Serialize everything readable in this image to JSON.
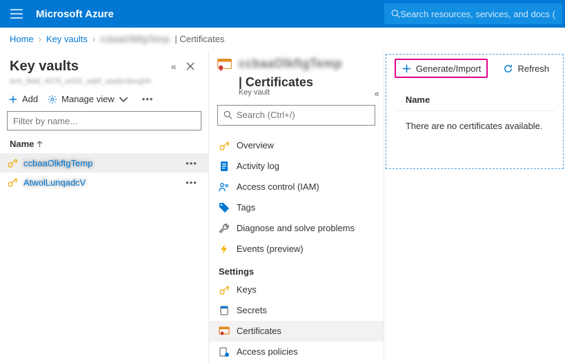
{
  "header": {
    "brand": "Microsoft Azure",
    "search_placeholder": "Search resources, services, and docs (G+/)"
  },
  "breadcrumbs": {
    "home": "Home",
    "vaults": "Key vaults",
    "resource": "ccbaaOlkftgTemp",
    "page": "Certificates"
  },
  "left_pane": {
    "title": "Key vaults",
    "subtitle": "text_field_4076_e026_aabf_aaabcdeeghh",
    "add": "Add",
    "manage_view": "Manage view",
    "filter_placeholder": "Filter by name...",
    "column": "Name",
    "items": [
      {
        "name": "ccbaaOlkftgTemp",
        "selected": true
      },
      {
        "name": "AtwolLunqadcV",
        "selected": false
      }
    ]
  },
  "mid_pane": {
    "resource": "ccbaaOlkftgTemp",
    "suffix": "Certificates",
    "type_label": "Key vault",
    "search_placeholder": "Search (Ctrl+/)",
    "section_settings": "Settings",
    "nav": {
      "overview": "Overview",
      "activity": "Activity log",
      "iam": "Access control (IAM)",
      "tags": "Tags",
      "diag": "Diagnose and solve problems",
      "events": "Events (preview)",
      "keys": "Keys",
      "secrets": "Secrets",
      "certs": "Certificates",
      "accesspol": "Access policies"
    }
  },
  "right_pane": {
    "generate": "Generate/Import",
    "refresh": "Refresh",
    "column": "Name",
    "empty": "There are no certificates available."
  }
}
